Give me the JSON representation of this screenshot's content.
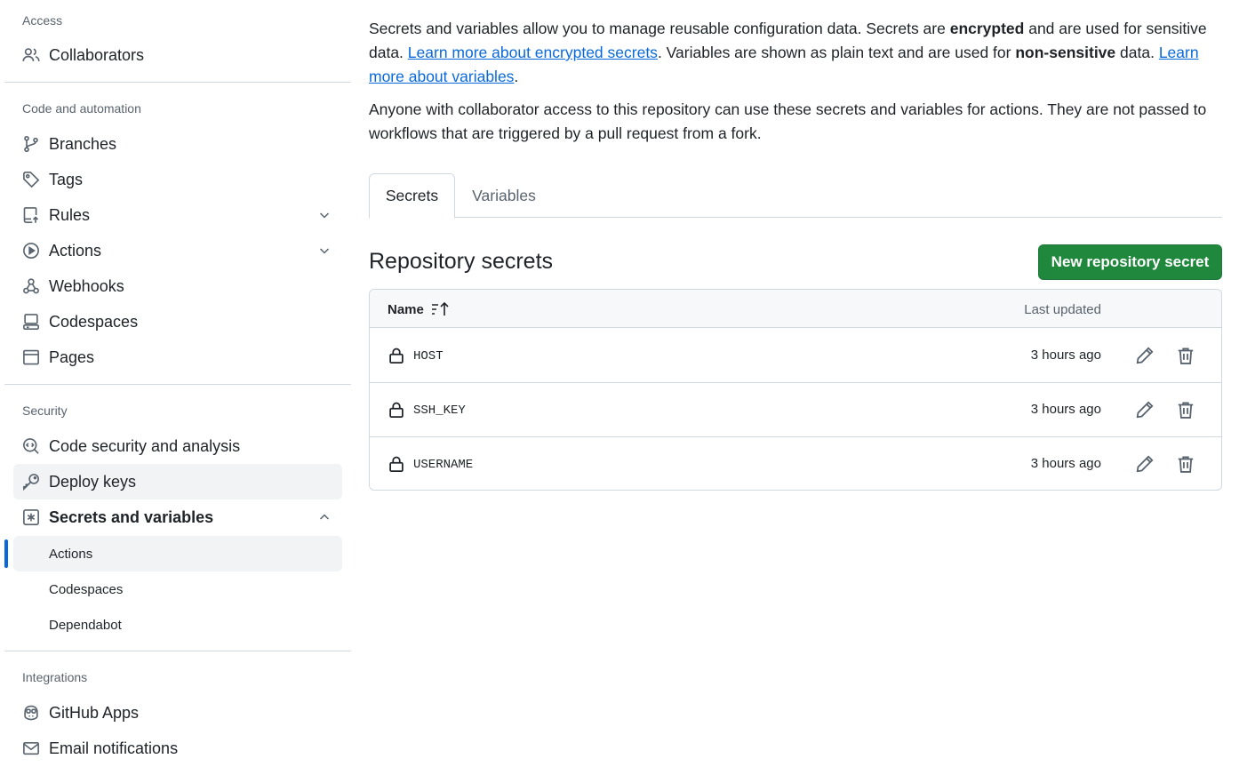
{
  "sidebar": {
    "sections": {
      "access": "Access",
      "code_automation": "Code and automation",
      "security": "Security",
      "integrations": "Integrations"
    },
    "items": {
      "collaborators": "Collaborators",
      "branches": "Branches",
      "tags": "Tags",
      "rules": "Rules",
      "actions": "Actions",
      "webhooks": "Webhooks",
      "codespaces": "Codespaces",
      "pages": "Pages",
      "code_security": "Code security and analysis",
      "deploy_keys": "Deploy keys",
      "secrets_vars": "Secrets and variables",
      "github_apps": "GitHub Apps",
      "email_notifications": "Email notifications"
    },
    "subitems": {
      "actions": "Actions",
      "codespaces": "Codespaces",
      "dependabot": "Dependabot"
    }
  },
  "main": {
    "intro": {
      "p1_a": "Secrets and variables allow you to manage reusable configuration data. Secrets are ",
      "p1_b": "encrypted",
      "p1_c": " and are used for sensitive data. ",
      "p1_link1": "Learn more about encrypted secrets",
      "p1_d": ". Variables are shown as plain text and are used for ",
      "p1_e": "non-sensitive",
      "p1_f": " data. ",
      "p1_link2": "Learn more about variables",
      "p1_g": ".",
      "p2": "Anyone with collaborator access to this repository can use these secrets and variables for actions. They are not passed to workflows that are triggered by a pull request from a fork."
    },
    "tabs": [
      "Secrets",
      "Variables"
    ],
    "repo_secrets_title": "Repository secrets",
    "new_button": "New repository secret",
    "table": {
      "col_name": "Name",
      "col_updated": "Last updated",
      "rows": [
        {
          "name": "HOST",
          "updated": "3 hours ago"
        },
        {
          "name": "SSH_KEY",
          "updated": "3 hours ago"
        },
        {
          "name": "USERNAME",
          "updated": "3 hours ago"
        }
      ]
    }
  },
  "colors": {
    "accent": "#0969da",
    "primary_button": "#1f883d",
    "border": "#d1d9e0",
    "muted": "#59636e"
  }
}
